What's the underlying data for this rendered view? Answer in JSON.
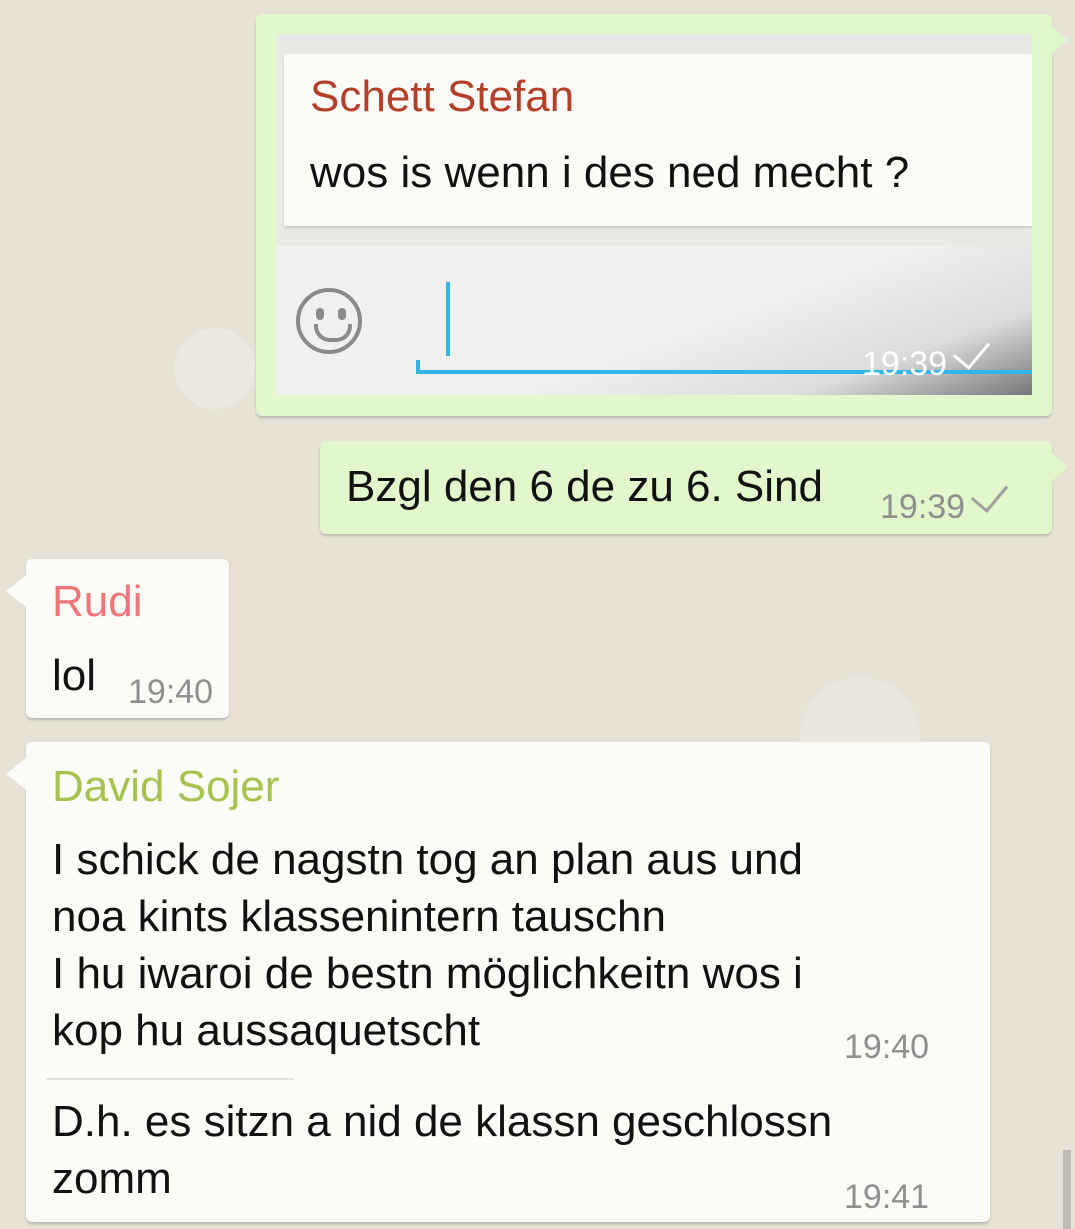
{
  "messages": [
    {
      "type": "outgoing-screenshot",
      "quoted_sender": "Schett Stefan",
      "quoted_text": "wos is wenn i des ned mecht ?",
      "time": "19:39"
    },
    {
      "type": "outgoing",
      "text": "Bzgl den 6 de zu 6. Sind",
      "time": "19:39"
    },
    {
      "type": "incoming",
      "sender": "Rudi",
      "text": "lol",
      "time": "19:40"
    },
    {
      "type": "incoming",
      "sender": "David Sojer",
      "parts": [
        {
          "lines": [
            "I schick de nagstn tog an plan aus und",
            "noa kints klassenintern tauschn",
            "I hu iwaroi de bestn möglichkeitn wos i",
            "kop hu aussaquetscht"
          ],
          "time": "19:40"
        },
        {
          "lines": [
            "D.h. es sitzn a nid de klassn geschlossn",
            "zomm"
          ],
          "time": "19:41"
        }
      ]
    }
  ],
  "colors": {
    "outgoing_bg": "#e2f7cb",
    "incoming_bg": "#fbfbf7",
    "sender_schett": "#b5402a",
    "sender_rudi": "#f0767a",
    "sender_david": "#a7c34e",
    "input_accent": "#33b5e5"
  },
  "icons": [
    "smiley-icon",
    "check-icon"
  ]
}
